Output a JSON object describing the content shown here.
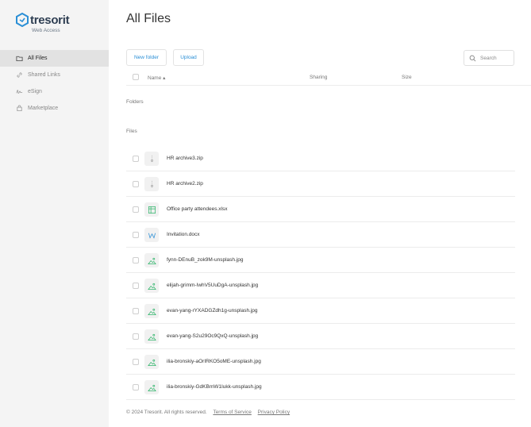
{
  "brand": {
    "name": "tresorit",
    "subtitle": "Web Access",
    "color": "#2b8fd6"
  },
  "sidebar": {
    "items": [
      {
        "label": "All Files",
        "icon": "folder-icon",
        "active": true
      },
      {
        "label": "Shared Links",
        "icon": "link-icon",
        "active": false
      },
      {
        "label": "eSign",
        "icon": "signature-icon",
        "active": false
      },
      {
        "label": "Marketplace",
        "icon": "bag-icon",
        "active": false
      }
    ]
  },
  "main": {
    "title": "All Files",
    "toolbar": {
      "new_folder": "New folder",
      "upload": "Upload",
      "search_placeholder": "Search"
    },
    "columns": {
      "name": "Name ▴",
      "sharing": "Sharing",
      "size": "Size"
    },
    "sections": {
      "folders": "Folders",
      "files": "Files"
    },
    "files": [
      {
        "name": "HR archive3.zip",
        "icon": "zip-icon"
      },
      {
        "name": "HR archive2.zip",
        "icon": "zip-icon"
      },
      {
        "name": "Office party attendees.xlsx",
        "icon": "spreadsheet-icon"
      },
      {
        "name": "Invitation.docx",
        "icon": "word-icon"
      },
      {
        "name": "fynn-DEnuB_zok9M-unsplash.jpg",
        "icon": "image-icon"
      },
      {
        "name": "elijah-grimm-IwhV5UuDgA-unsplash.jpg",
        "icon": "image-icon"
      },
      {
        "name": "evan-yang-rYXADGZdh1g-unsplash.jpg",
        "icon": "image-icon"
      },
      {
        "name": "evan-yang-S2u29Oc9QxQ-unsplash.jpg",
        "icon": "image-icon"
      },
      {
        "name": "ilia-bronskiy-aOrIRKO5oME-unsplash.jpg",
        "icon": "image-icon"
      },
      {
        "name": "ilia-bronskiy-GdKBmW1Iukk-unsplash.jpg",
        "icon": "image-icon"
      }
    ]
  },
  "footer": {
    "copyright": "© 2024 Tresorit. All rights reserved.",
    "terms": "Terms of Service",
    "privacy": "Privacy Policy"
  }
}
